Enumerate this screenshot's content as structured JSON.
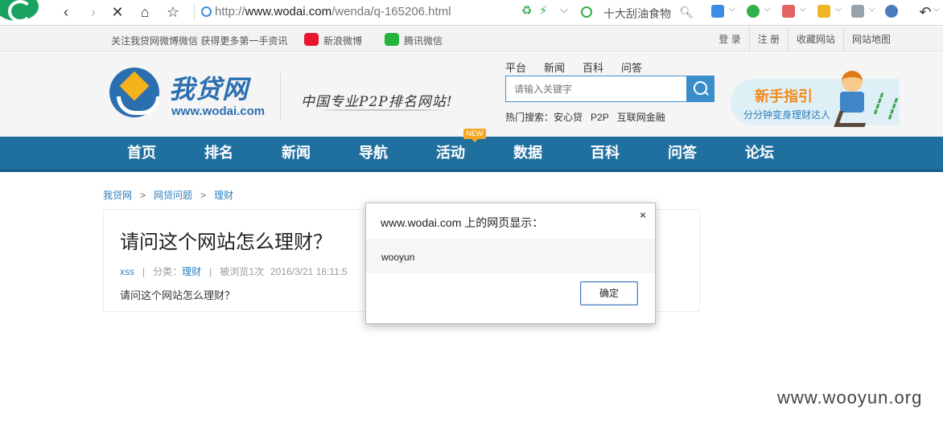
{
  "browser": {
    "url_prefix": "http://",
    "url_host": "www.wodai.com",
    "url_path": "/wenda/q-165206.html",
    "search_text": "十大刮油食物"
  },
  "topbar": {
    "follow_text": "关注我贷网微博微信 获得更多第一手资讯",
    "weibo": "新浪微博",
    "wechat": "腾讯微信",
    "links": [
      "登 录",
      "注 册",
      "收藏网站",
      "网站地图"
    ]
  },
  "header": {
    "logo_cn": "我贷网",
    "logo_en": "www.wodai.com",
    "slogan": "中国专业P2P排名网站!",
    "tabs": [
      "平台",
      "新闻",
      "百科",
      "问答"
    ],
    "search_placeholder": "请输入关键字",
    "hot_label": "热门搜索：",
    "hot_items": [
      "安心贷",
      "P2P",
      "互联网金融"
    ],
    "promo_title": "新手指引",
    "promo_sub": "分分钟变身理财达人"
  },
  "nav": {
    "items": [
      "首页",
      "排名",
      "新闻",
      "导航",
      "活动",
      "数据",
      "百科",
      "问答",
      "论坛"
    ],
    "new_badge": "NEW"
  },
  "breadcrumb": [
    "我贷网",
    "网贷问题",
    "理财"
  ],
  "breadcrumb_sep": ">",
  "article": {
    "title": "请问这个网站怎么理财？",
    "author": "xss",
    "category_label": "分类：",
    "category": "理财",
    "views": "被浏览1次",
    "date": "2016/3/21 16:11:5",
    "body": "请问这个网站怎么理财？"
  },
  "dialog": {
    "title": "www.wodai.com 上的网页显示：",
    "message": "wooyun",
    "ok": "确定",
    "close": "×"
  },
  "watermark": "www.wooyun.org"
}
